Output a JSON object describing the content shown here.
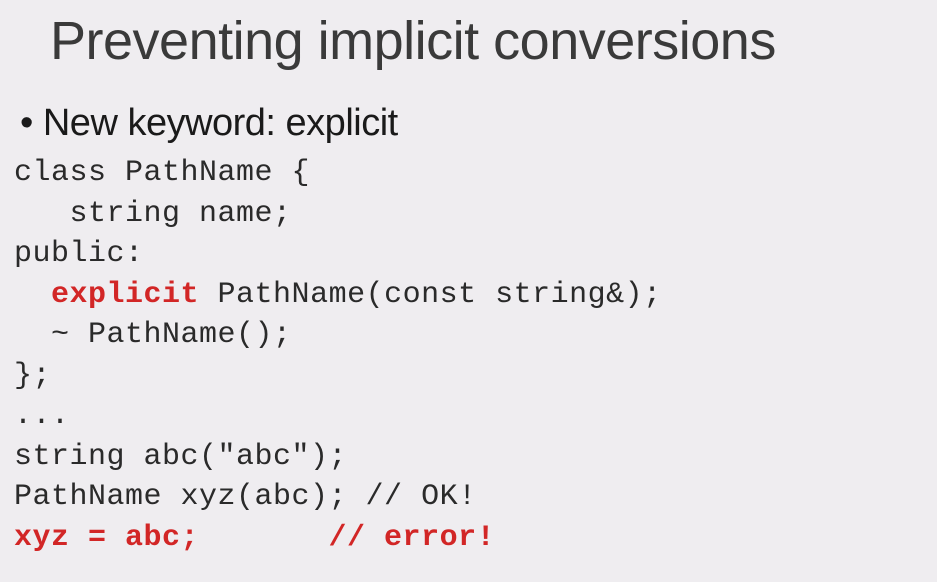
{
  "slide": {
    "title": "Preventing implicit conversions",
    "bullet": "• New keyword: explicit",
    "code": {
      "l1": "class PathName {",
      "l2": "   string name;",
      "l3": "public:",
      "l4a": "  ",
      "l4kw": "explicit",
      "l4b": " PathName(const string&);",
      "l5": "  ~ PathName();",
      "l6": "};",
      "l7": "...",
      "l8": "string abc(\"abc\");",
      "l9": "PathName xyz(abc); // OK!",
      "l10": "xyz = abc;       // error!"
    }
  }
}
